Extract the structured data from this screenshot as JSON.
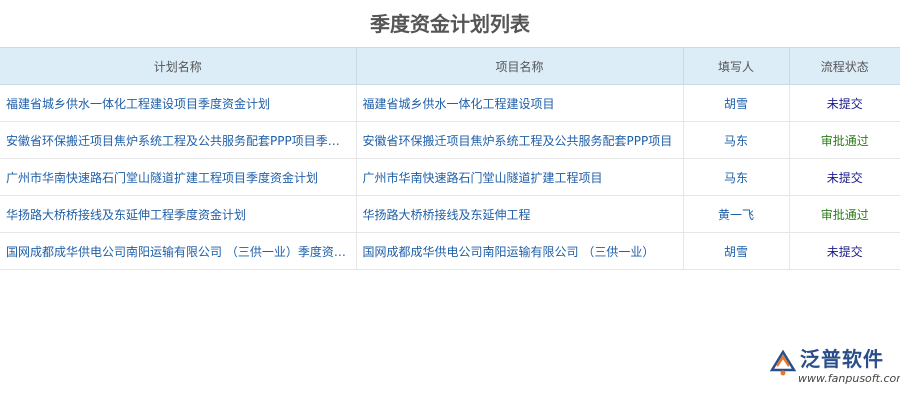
{
  "page": {
    "title": "季度资金计划列表"
  },
  "table": {
    "headers": [
      "计划名称",
      "项目名称",
      "填写人",
      "流程状态"
    ],
    "rows": [
      {
        "plan": "福建省城乡供水一体化工程建设项目季度资金计划",
        "project": "福建省城乡供水一体化工程建设项目",
        "user": "胡雪",
        "status": "未提交",
        "status_type": "draft"
      },
      {
        "plan": "安徽省环保搬迁项目焦炉系统工程及公共服务配套PPP项目季度资金计划",
        "project": "安徽省环保搬迁项目焦炉系统工程及公共服务配套PPP项目",
        "user": "马东",
        "status": "审批通过",
        "status_type": "ok"
      },
      {
        "plan": "广州市华南快速路石门堂山隧道扩建工程项目季度资金计划",
        "project": "广州市华南快速路石门堂山隧道扩建工程项目",
        "user": "马东",
        "status": "未提交",
        "status_type": "draft"
      },
      {
        "plan": "华扬路大桥桥接线及东延伸工程季度资金计划",
        "project": "华扬路大桥桥接线及东延伸工程",
        "user": "黄一飞",
        "status": "审批通过",
        "status_type": "ok"
      },
      {
        "plan": "国网成都成华供电公司南阳运输有限公司 （三供一业）季度资金计划",
        "project": "国网成都成华供电公司南阳运输有限公司 （三供一业）",
        "user": "胡雪",
        "status": "未提交",
        "status_type": "draft"
      }
    ]
  },
  "colors": {
    "header_bg": "#dcedf8",
    "link": "#1f5fa8",
    "status_draft": "#1a1a8c",
    "status_ok": "#2e7d1a"
  },
  "logo": {
    "name": "泛普软件",
    "url": "www.fanpusoft.com",
    "icon": "fanpu-logo-icon"
  }
}
